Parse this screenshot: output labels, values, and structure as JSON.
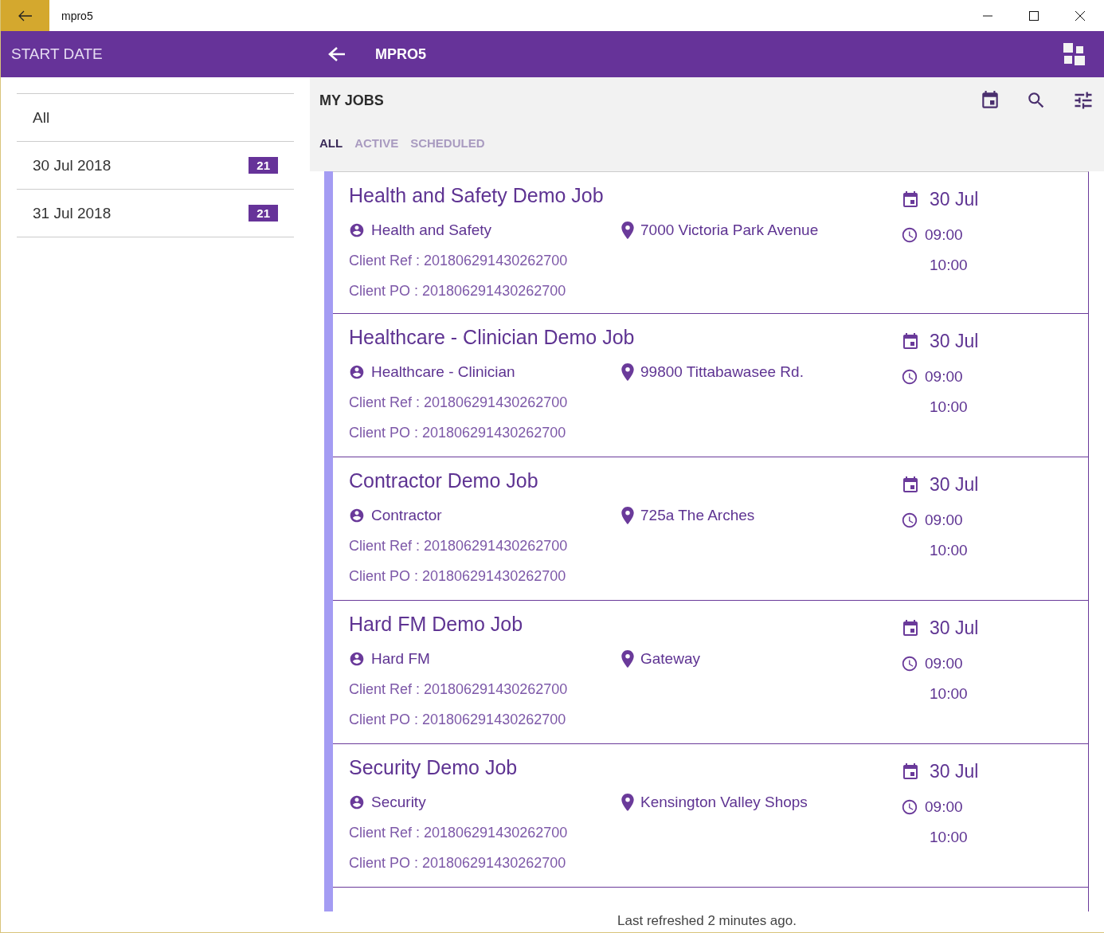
{
  "window": {
    "title": "mpro5"
  },
  "app_bar": {
    "section_title": "START DATE",
    "title": "MPRO5"
  },
  "sidebar": {
    "items": [
      {
        "label": "All",
        "selected": false
      },
      {
        "label": "30 Jul 2018",
        "count": "21",
        "selected": false
      },
      {
        "label": "31 Jul 2018",
        "count": "21",
        "selected": false
      }
    ]
  },
  "jobs_panel": {
    "title": "MY JOBS",
    "tabs": [
      {
        "label": "ALL",
        "selected": true
      },
      {
        "label": "ACTIVE",
        "selected": false
      },
      {
        "label": "SCHEDULED",
        "selected": false
      }
    ],
    "jobs": [
      {
        "title": "Health and Safety Demo Job",
        "category": "Health and Safety",
        "address": "7000 Victoria Park Avenue",
        "client_ref": "Client Ref : 201806291430262700",
        "client_po": "Client PO : 201806291430262700",
        "date": "30 Jul",
        "start_time": "09:00",
        "end_time": "10:00"
      },
      {
        "title": "Healthcare - Clinician Demo Job",
        "category": "Healthcare - Clinician",
        "address": "99800 Tittabawasee Rd.",
        "client_ref": "Client Ref : 201806291430262700",
        "client_po": "Client PO : 201806291430262700",
        "date": "30 Jul",
        "start_time": "09:00",
        "end_time": "10:00"
      },
      {
        "title": "Contractor Demo Job",
        "category": "Contractor",
        "address": "725a The Arches",
        "client_ref": "Client Ref : 201806291430262700",
        "client_po": "Client PO : 201806291430262700",
        "date": "30 Jul",
        "start_time": "09:00",
        "end_time": "10:00"
      },
      {
        "title": "Hard FM Demo Job",
        "category": "Hard FM",
        "address": "Gateway",
        "client_ref": "Client Ref : 201806291430262700",
        "client_po": "Client PO : 201806291430262700",
        "date": "30 Jul",
        "start_time": "09:00",
        "end_time": "10:00"
      },
      {
        "title": "Security Demo Job",
        "category": "Security",
        "address": "Kensington Valley Shops",
        "client_ref": "Client Ref : 201806291430262700",
        "client_po": "Client PO : 201806291430262700",
        "date": "30 Jul",
        "start_time": "09:00",
        "end_time": "10:00"
      }
    ]
  },
  "status_bar": "Last refreshed 2 minutes ago."
}
